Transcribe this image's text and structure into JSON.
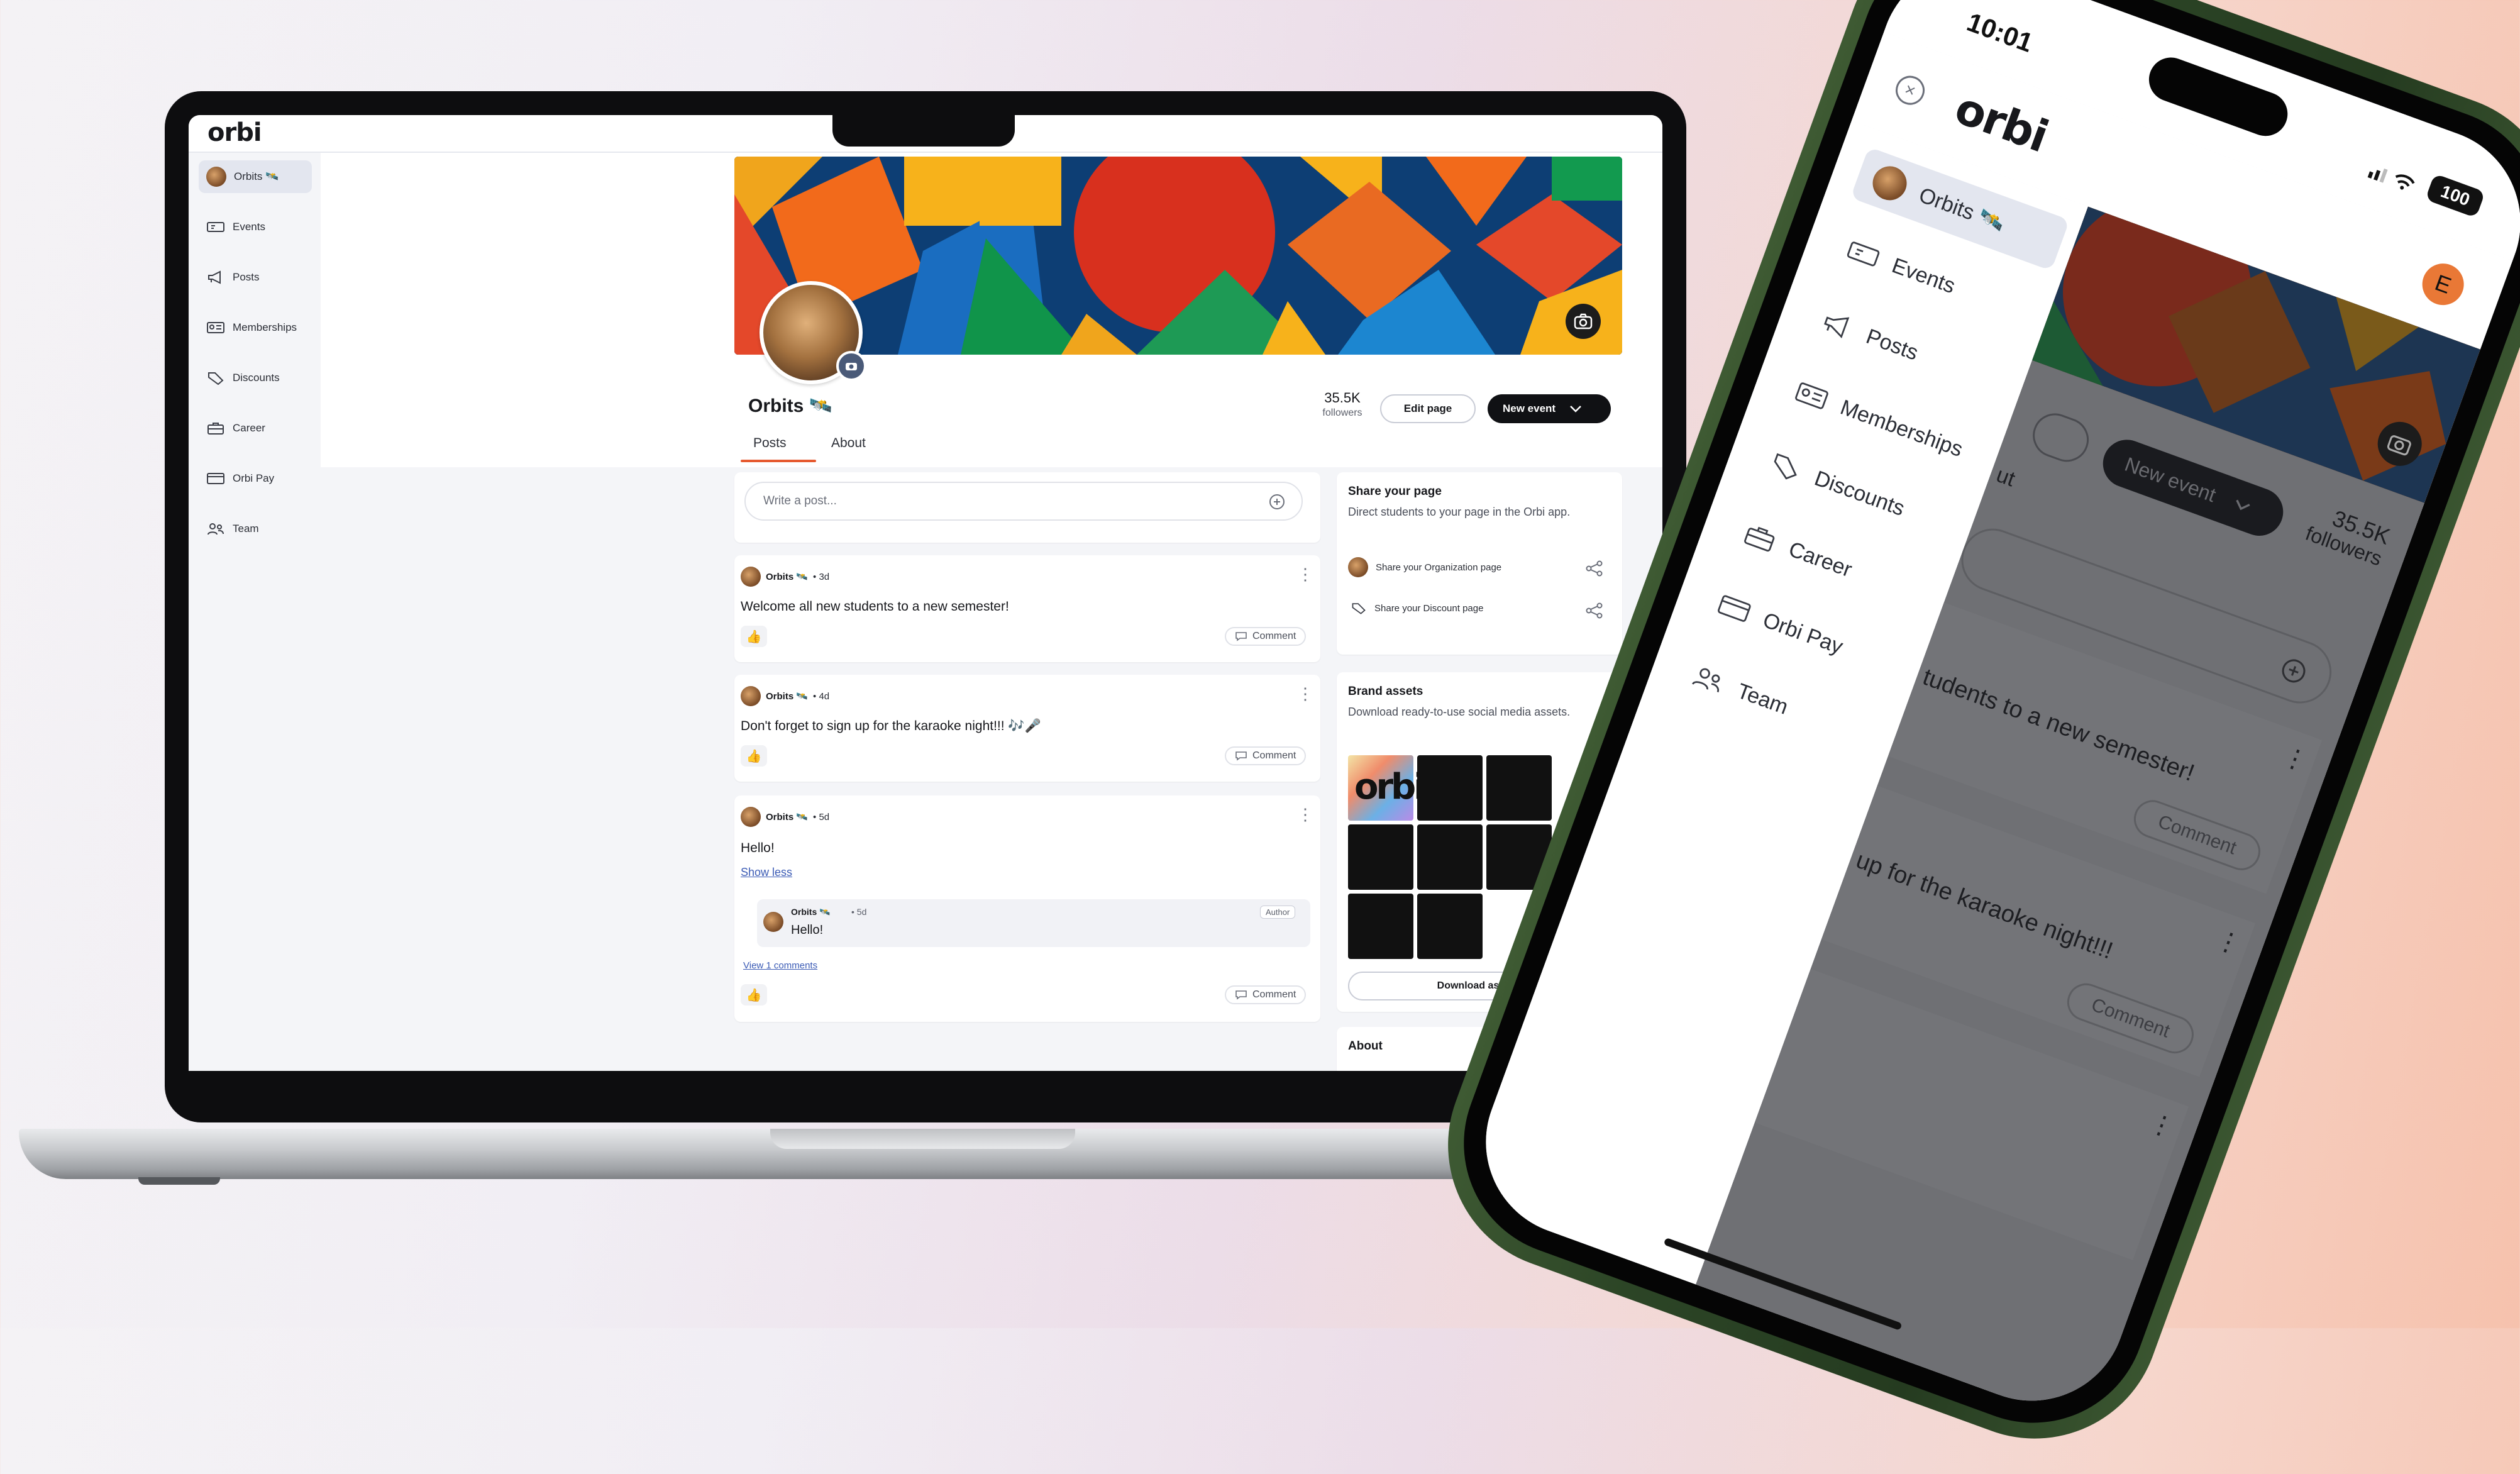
{
  "brand": {
    "logo": "orbi",
    "accent": "#e65a30",
    "dark": "#101114"
  },
  "sidebar": {
    "items": [
      {
        "label": "Orbits 🛰️",
        "icon": "avatar",
        "active": true
      },
      {
        "label": "Events",
        "icon": "ticket-icon"
      },
      {
        "label": "Posts",
        "icon": "megaphone-icon"
      },
      {
        "label": "Memberships",
        "icon": "id-card-icon"
      },
      {
        "label": "Discounts",
        "icon": "tag-icon"
      },
      {
        "label": "Career",
        "icon": "briefcase-icon"
      },
      {
        "label": "Orbi Pay",
        "icon": "card-icon"
      },
      {
        "label": "Team",
        "icon": "team-icon"
      }
    ]
  },
  "profile": {
    "name": "Orbits 🛰️",
    "followers_count": "35.5K",
    "followers_label": "followers",
    "edit_label": "Edit page",
    "new_event_label": "New event",
    "tabs": [
      "Posts",
      "About"
    ]
  },
  "composer": {
    "placeholder": "Write a post..."
  },
  "posts": [
    {
      "author": "Orbits 🛰️",
      "age": "• 3d",
      "text": "Welcome all new students to a new semester!",
      "comment_label": "Comment"
    },
    {
      "author": "Orbits 🛰️",
      "age": "• 4d",
      "text": "Don't forget to sign up for the karaoke night!!! 🎶🎤",
      "comment_label": "Comment"
    },
    {
      "author": "Orbits 🛰️",
      "age": "• 5d",
      "text": "Hello!",
      "show_less": "Show less",
      "reply": {
        "author": "Orbits 🛰️",
        "age": "• 5d",
        "badge": "Author",
        "text": "Hello!"
      },
      "view_comments": "View 1 comments",
      "comment_label": "Comment"
    }
  ],
  "share_card": {
    "title": "Share your page",
    "text": "Direct students to your page in the Orbi app.",
    "links": [
      "Share your Organization page",
      "Share your Discount page"
    ]
  },
  "brand_assets": {
    "title": "Brand assets",
    "text": "Download ready-to-use social media assets.",
    "download_label": "Download assets"
  },
  "about_card": {
    "title": "About"
  },
  "phone": {
    "time": "10:01",
    "battery": "100",
    "user_initial": "E",
    "followers_count": "35.5K",
    "followers_label": "followers",
    "new_event_label": "New event",
    "tab_fragment": "ut",
    "post1_fragment": "tudents to a new semester!",
    "post2_fragment": "up for the karaoke night!!!",
    "comment_label": "Comment"
  }
}
